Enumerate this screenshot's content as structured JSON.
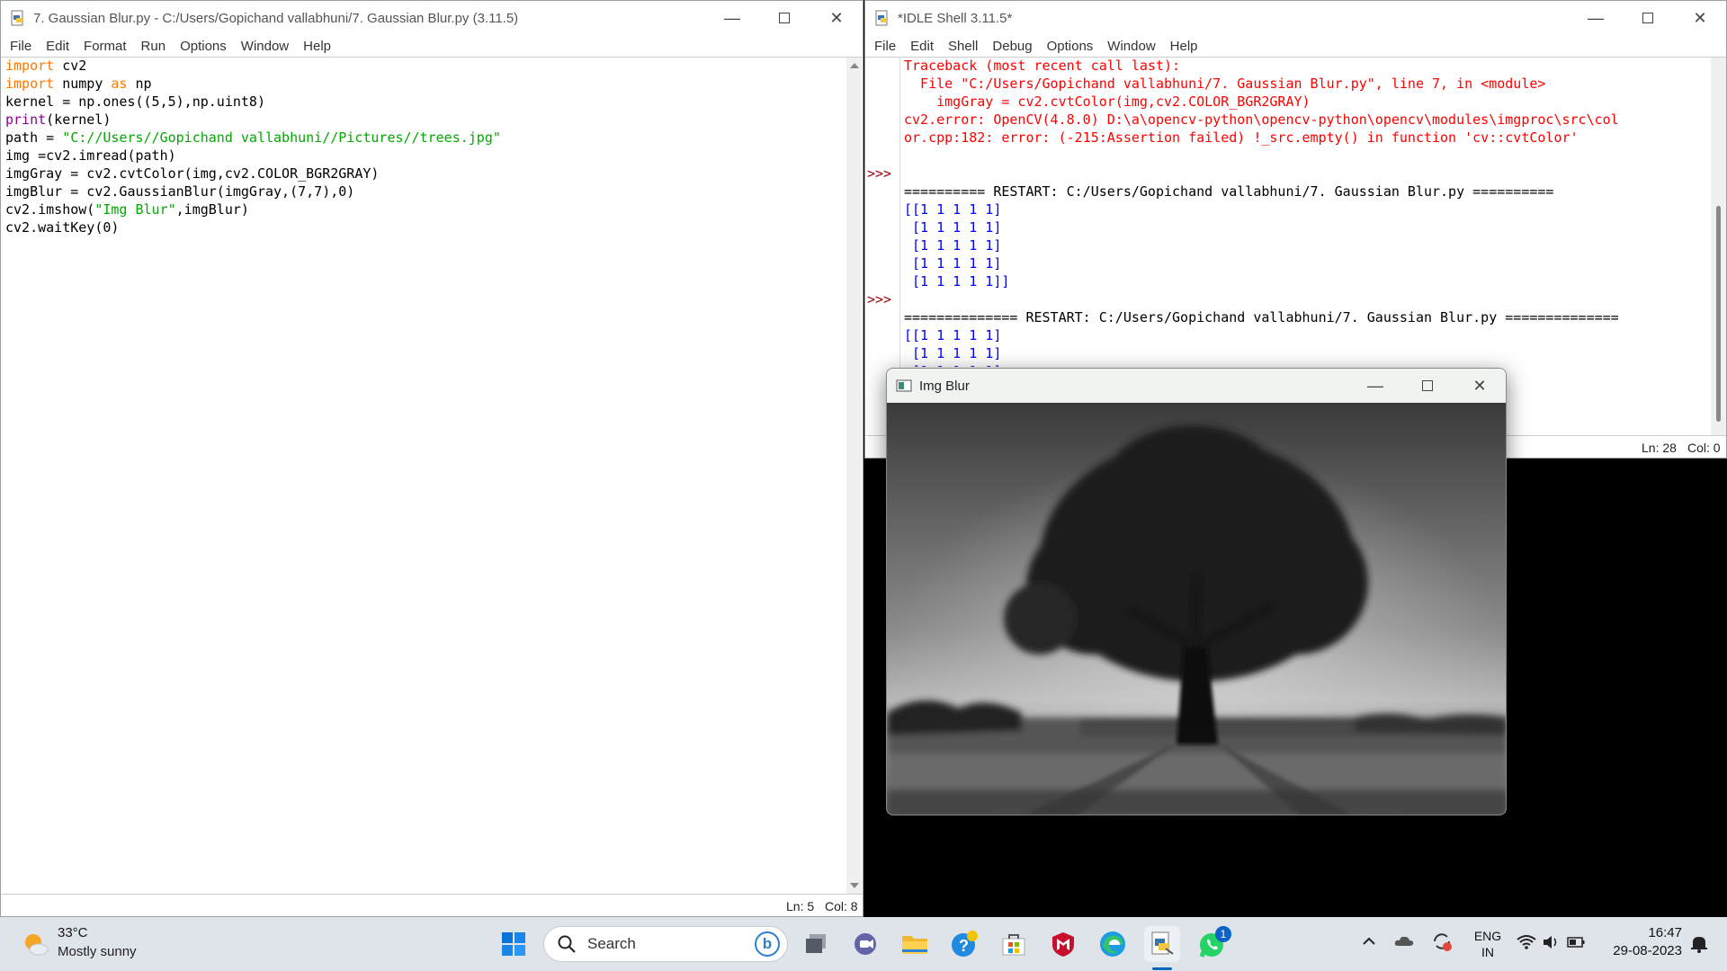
{
  "editor": {
    "title": "7. Gaussian Blur.py - C:/Users/Gopichand vallabhuni/7. Gaussian Blur.py (3.11.5)",
    "menu": [
      "File",
      "Edit",
      "Format",
      "Run",
      "Options",
      "Window",
      "Help"
    ],
    "code": [
      [
        [
          "kw",
          "import"
        ],
        [
          "plain",
          " cv2"
        ]
      ],
      [
        [
          "kw",
          "import"
        ],
        [
          "plain",
          " numpy "
        ],
        [
          "kw",
          "as"
        ],
        [
          "plain",
          " np"
        ]
      ],
      [
        [
          "plain",
          "kernel = np.ones((5,5),np.uint8)"
        ]
      ],
      [
        [
          "bi",
          "print"
        ],
        [
          "plain",
          "(kernel)"
        ]
      ],
      [
        [
          "plain",
          "path = "
        ],
        [
          "str",
          "\"C://Users//Gopichand vallabhuni//Pictures//trees.jpg\""
        ]
      ],
      [
        [
          "plain",
          "img =cv2.imread(path)"
        ]
      ],
      [
        [
          "plain",
          "imgGray = cv2.cvtColor(img,cv2.COLOR_BGR2GRAY)"
        ]
      ],
      [
        [
          "plain",
          "imgBlur = cv2.GaussianBlur(imgGray,(7,7),0)"
        ]
      ],
      [
        [
          "plain",
          "cv2.imshow("
        ],
        [
          "str",
          "\"Img Blur\""
        ],
        [
          "plain",
          ",imgBlur)"
        ]
      ],
      [
        [
          "plain",
          "cv2.waitKey(0)"
        ]
      ]
    ],
    "status": {
      "ln": "Ln: 5",
      "col": "Col: 8"
    }
  },
  "shell": {
    "title": "*IDLE Shell 3.11.5*",
    "menu": [
      "File",
      "Edit",
      "Shell",
      "Debug",
      "Options",
      "Window",
      "Help"
    ],
    "lines": [
      {
        "type": "err",
        "text": "Traceback (most recent call last):",
        "prompt": ""
      },
      {
        "type": "err",
        "text": "  File \"C:/Users/Gopichand vallabhuni/7. Gaussian Blur.py\", line 7, in <module>",
        "prompt": ""
      },
      {
        "type": "err",
        "text": "    imgGray = cv2.cvtColor(img,cv2.COLOR_BGR2GRAY)",
        "prompt": ""
      },
      {
        "type": "err",
        "text": "cv2.error: OpenCV(4.8.0) D:\\a\\opencv-python\\opencv-python\\opencv\\modules\\imgproc\\src\\col",
        "prompt": ""
      },
      {
        "type": "err",
        "text": "or.cpp:182: error: (-215:Assertion failed) !_src.empty() in function 'cv::cvtColor'",
        "prompt": ""
      },
      {
        "type": "plain",
        "text": "",
        "prompt": ""
      },
      {
        "type": "plain",
        "text": "",
        "prompt": ">>>"
      },
      {
        "type": "plain",
        "text": "========== RESTART: C:/Users/Gopichand vallabhuni/7. Gaussian Blur.py ==========",
        "prompt": ""
      },
      {
        "type": "out",
        "text": "[[1 1 1 1 1]",
        "prompt": ""
      },
      {
        "type": "out",
        "text": " [1 1 1 1 1]",
        "prompt": ""
      },
      {
        "type": "out",
        "text": " [1 1 1 1 1]",
        "prompt": ""
      },
      {
        "type": "out",
        "text": " [1 1 1 1 1]",
        "prompt": ""
      },
      {
        "type": "out",
        "text": " [1 1 1 1 1]]",
        "prompt": ""
      },
      {
        "type": "plain",
        "text": "",
        "prompt": ">>>"
      },
      {
        "type": "plain",
        "text": "============== RESTART: C:/Users/Gopichand vallabhuni/7. Gaussian Blur.py ==============",
        "prompt": ""
      },
      {
        "type": "out",
        "text": "[[1 1 1 1 1]",
        "prompt": ""
      },
      {
        "type": "out",
        "text": " [1 1 1 1 1]",
        "prompt": ""
      },
      {
        "type": "out",
        "text": " [1 1 1 1 1]",
        "prompt": ""
      }
    ],
    "status": {
      "ln": "Ln: 28",
      "col": "Col: 0"
    }
  },
  "imgwin": {
    "title": "Img Blur"
  },
  "taskbar": {
    "weather_temp": "33°C",
    "weather_desc": "Mostly sunny",
    "search_label": "Search",
    "lang_top": "ENG",
    "lang_bottom": "IN",
    "time": "16:47",
    "date": "29-08-2023",
    "whatsapp_badge": "1",
    "colors": {
      "accent": "#0067c0",
      "taskbar_bg": "#dfe3ea"
    }
  }
}
